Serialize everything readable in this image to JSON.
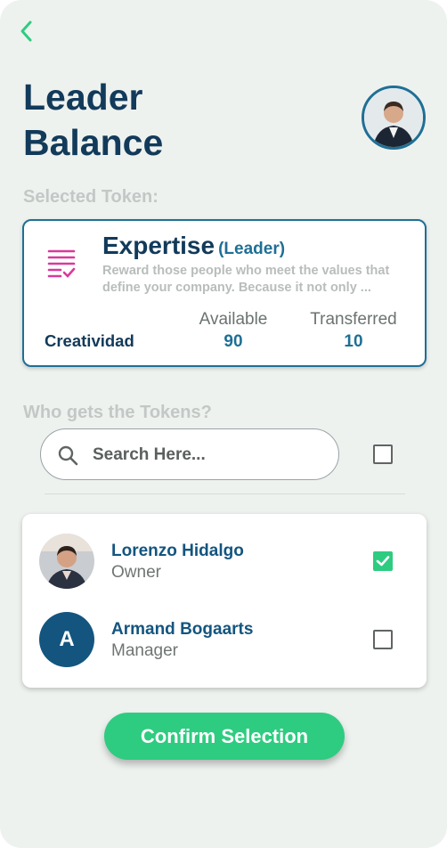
{
  "header": {
    "title_line1": "Leader",
    "title_line2": "Balance"
  },
  "icons": {
    "back": "chevron-left-icon",
    "token": "checklist-icon",
    "search": "search-icon"
  },
  "colors": {
    "accent_green": "#2ecc80",
    "primary_blue": "#13557f",
    "token_icon_pink": "#d9399a"
  },
  "selected_token": {
    "section_label": "Selected Token:",
    "name": "Expertise",
    "role": "(Leader)",
    "description": "Reward those people who meet the values that define your company. Because it not only ...",
    "category": "Creatividad",
    "available_label": "Available",
    "available_value": "90",
    "transferred_label": "Transferred",
    "transferred_value": "10"
  },
  "recipients": {
    "section_label": "Who gets the Tokens?",
    "search_placeholder": "Search Here...",
    "select_all_checked": false,
    "people": [
      {
        "name": "Lorenzo Hidalgo",
        "role": "Owner",
        "checked": true
      },
      {
        "name": "Armand Bogaarts",
        "role": "Manager",
        "initial": "A",
        "checked": false
      }
    ]
  },
  "actions": {
    "confirm_label": "Confirm Selection"
  }
}
